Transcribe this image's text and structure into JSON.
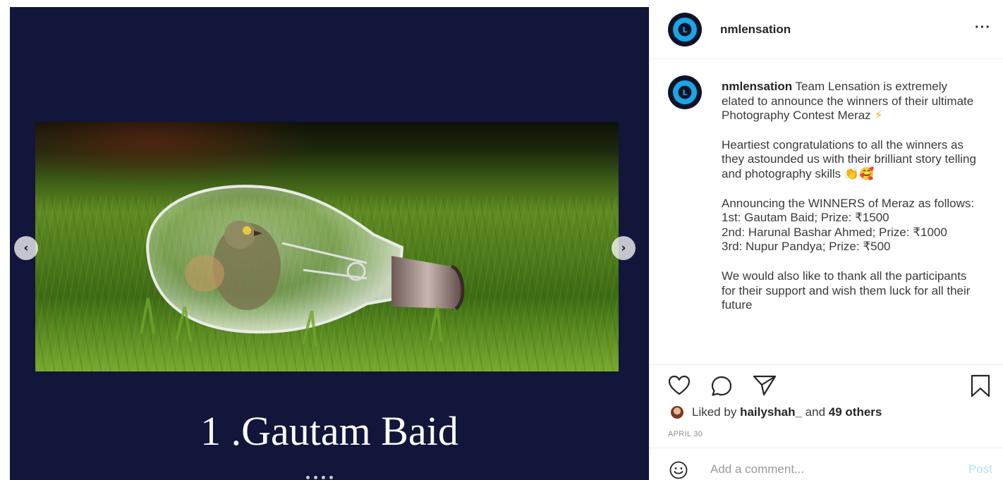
{
  "post": {
    "username": "nmlensation",
    "avatar_letter": "L",
    "more_label": "···",
    "slide_caption": "1 .Gautam Baid",
    "carousel_dots": 4,
    "caption": {
      "username": "nmlensation",
      "line1": "Team Lensation is extremely elated to announce the winners of their ultimate Photography Contest Meraz",
      "line1_emoji": "⚡",
      "para2": "Heartiest congratulations to all the winners as they astounded us with their brilliant story telling and photography skills",
      "para2_emoji": "👏🥰",
      "para3_intro": "Announcing the WINNERS of Meraz as follows:",
      "winner1": "1st: Gautam Baid; Prize: ₹1500",
      "winner2": "2nd: Harunal Bashar Ahmed; Prize: ₹1000",
      "winner3": "3rd: Nupur Pandya; Prize: ₹500",
      "para4": "We would also like to thank all the participants for their support and wish them luck for all their future"
    },
    "likes": {
      "prefix": "Liked by ",
      "user": "hailyshah_",
      "middle": " and ",
      "others": "49 others"
    },
    "date": "APRIL 30",
    "comment": {
      "placeholder": "Add a comment...",
      "post_label": "Post"
    }
  },
  "icons": {
    "prev": "chevron-left-icon",
    "next": "chevron-right-icon",
    "like": "heart-icon",
    "comment": "speech-bubble-icon",
    "share": "paper-plane-icon",
    "save": "bookmark-icon",
    "emoji": "smiley-icon"
  },
  "colors": {
    "media_bg": "#11163a",
    "avatar_ring": "#1aa6e8",
    "post_button": "#b2dffc"
  }
}
